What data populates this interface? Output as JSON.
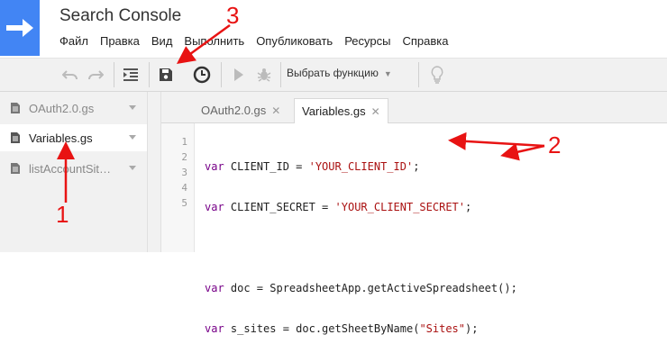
{
  "app": {
    "title": "Search Console"
  },
  "menu": [
    "Файл",
    "Правка",
    "Вид",
    "Выполнить",
    "Опубликовать",
    "Ресурсы",
    "Справка"
  ],
  "toolbar": {
    "function_select": "Выбрать функцию"
  },
  "sidebar": {
    "files": [
      {
        "name": "OAuth2.0.gs",
        "active": false
      },
      {
        "name": "Variables.gs",
        "active": true
      },
      {
        "name": "listAccountSit…",
        "active": false
      }
    ]
  },
  "tabs": [
    {
      "label": "OAuth2.0.gs",
      "active": false
    },
    {
      "label": "Variables.gs",
      "active": true
    }
  ],
  "editor": {
    "line_numbers": [
      "1",
      "2",
      "3",
      "4",
      "5"
    ],
    "lines": [
      {
        "kw": "var",
        "rest": " CLIENT_ID = ",
        "str": "'YOUR_CLIENT_ID'",
        "tail": ";"
      },
      {
        "kw": "var",
        "rest": " CLIENT_SECRET = ",
        "str": "'YOUR_CLIENT_SECRET'",
        "tail": ";"
      },
      {
        "kw": "",
        "rest": "",
        "str": "",
        "tail": ""
      },
      {
        "kw": "var",
        "rest": " doc = SpreadsheetApp.getActiveSpreadsheet();",
        "str": "",
        "tail": ""
      },
      {
        "kw": "var",
        "rest": " s_sites = doc.getSheetByName(",
        "str": "\"Sites\"",
        "tail": ");"
      }
    ]
  },
  "annotations": {
    "label_1": "1",
    "label_2": "2",
    "label_3": "3",
    "color": "#e81313"
  },
  "colors": {
    "brand": "#4285f4",
    "keyword": "#770088",
    "string": "#aa1111"
  }
}
